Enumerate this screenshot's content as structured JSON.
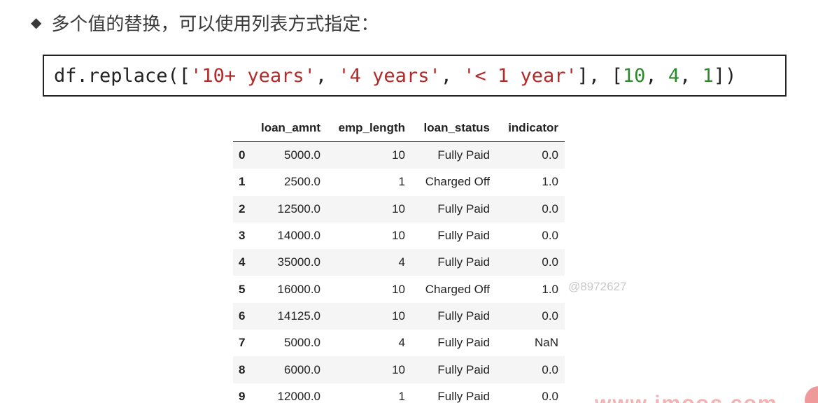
{
  "heading": {
    "bullet_icon": "diamond-bullet-icon",
    "text": "多个值的替换，可以使用列表方式指定："
  },
  "code": {
    "tokens": [
      {
        "t": "df.replace([",
        "k": "plain"
      },
      {
        "t": "'10+ years'",
        "k": "str"
      },
      {
        "t": ", ",
        "k": "plain"
      },
      {
        "t": "'4 years'",
        "k": "str"
      },
      {
        "t": ", ",
        "k": "plain"
      },
      {
        "t": "'< 1 year'",
        "k": "str"
      },
      {
        "t": "], [",
        "k": "plain"
      },
      {
        "t": "10",
        "k": "num"
      },
      {
        "t": ", ",
        "k": "plain"
      },
      {
        "t": "4",
        "k": "num"
      },
      {
        "t": ", ",
        "k": "plain"
      },
      {
        "t": "1",
        "k": "num"
      },
      {
        "t": "])",
        "k": "plain"
      }
    ],
    "colors": {
      "string": "#b32a2a",
      "number": "#2a8a2a",
      "plain": "#222222"
    }
  },
  "table": {
    "columns": [
      "loan_amnt",
      "emp_length",
      "loan_status",
      "indicator"
    ],
    "rows": [
      {
        "index": "0",
        "cells": [
          "5000.0",
          "10",
          "Fully Paid",
          "0.0"
        ]
      },
      {
        "index": "1",
        "cells": [
          "2500.0",
          "1",
          "Charged Off",
          "1.0"
        ]
      },
      {
        "index": "2",
        "cells": [
          "12500.0",
          "10",
          "Fully Paid",
          "0.0"
        ]
      },
      {
        "index": "3",
        "cells": [
          "14000.0",
          "10",
          "Fully Paid",
          "0.0"
        ]
      },
      {
        "index": "4",
        "cells": [
          "35000.0",
          "4",
          "Fully Paid",
          "0.0"
        ]
      },
      {
        "index": "5",
        "cells": [
          "16000.0",
          "10",
          "Charged Off",
          "1.0"
        ]
      },
      {
        "index": "6",
        "cells": [
          "14125.0",
          "10",
          "Fully Paid",
          "0.0"
        ]
      },
      {
        "index": "7",
        "cells": [
          "5000.0",
          "4",
          "Fully Paid",
          "NaN"
        ]
      },
      {
        "index": "8",
        "cells": [
          "6000.0",
          "10",
          "Fully Paid",
          "0.0"
        ]
      },
      {
        "index": "9",
        "cells": [
          "12000.0",
          "1",
          "Fully Paid",
          "0.0"
        ]
      }
    ]
  },
  "watermark": "@8972627",
  "site_mark": "www.imooc.com"
}
